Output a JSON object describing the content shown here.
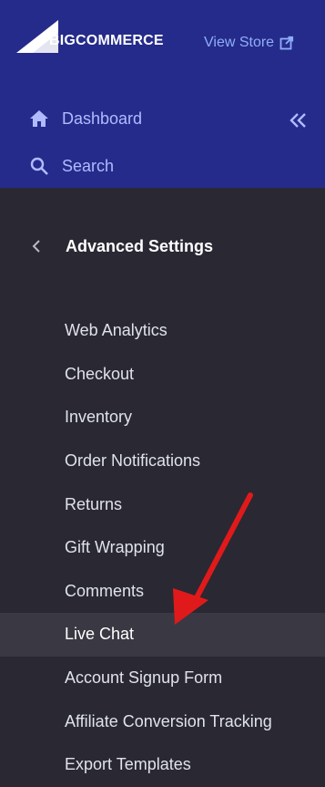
{
  "brand": {
    "big": "BIG",
    "commerce": "COMMERCE"
  },
  "header": {
    "view_store": "View Store"
  },
  "nav": {
    "dashboard": "Dashboard",
    "search": "Search"
  },
  "section": {
    "title": "Advanced Settings"
  },
  "menu": {
    "items": [
      {
        "label": "Web Analytics"
      },
      {
        "label": "Checkout"
      },
      {
        "label": "Inventory"
      },
      {
        "label": "Order Notifications"
      },
      {
        "label": "Returns"
      },
      {
        "label": "Gift Wrapping"
      },
      {
        "label": "Comments"
      },
      {
        "label": "Live Chat",
        "active": true
      },
      {
        "label": "Account Signup Form"
      },
      {
        "label": "Affiliate Conversion Tracking"
      },
      {
        "label": "Export Templates"
      }
    ]
  },
  "colors": {
    "top_bg": "#252b8a",
    "sidebar_bg": "#2a2833",
    "active_bg": "#3a3843",
    "link": "#8faef8",
    "arrow": "#e01a1a"
  },
  "icons": {
    "dashboard": "home-icon",
    "search": "search-icon",
    "collapse": "double-chevron-left-icon",
    "back": "chevron-left-icon",
    "external": "external-link-icon"
  }
}
